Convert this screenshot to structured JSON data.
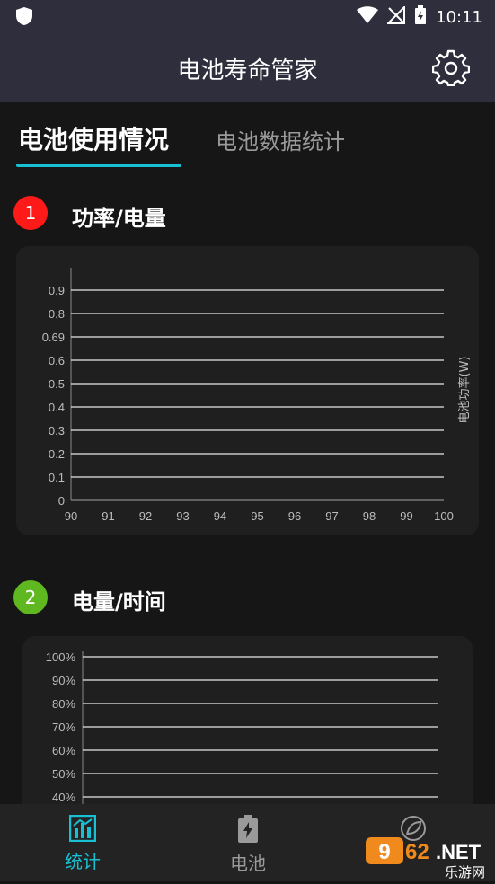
{
  "status_bar": {
    "time": "10:11"
  },
  "app": {
    "title": "电池寿命管家"
  },
  "tabs": [
    {
      "label": "电池使用情况",
      "active": true
    },
    {
      "label": "电池数据统计",
      "active": false
    }
  ],
  "sections": [
    {
      "number": "1",
      "title": "功率/电量",
      "badge_color": "#ff1a1a"
    },
    {
      "number": "2",
      "title": "电量/时间",
      "badge_color": "#5fb820"
    }
  ],
  "chart_data": [
    {
      "type": "line",
      "x": [],
      "series": [],
      "xticks": [
        "90",
        "91",
        "92",
        "93",
        "94",
        "95",
        "96",
        "97",
        "98",
        "99",
        "100"
      ],
      "yticks": [
        "0",
        "0.1",
        "0.2",
        "0.3",
        "0.4",
        "0.5",
        "0.6",
        "0.69",
        "0.8",
        "0.9"
      ],
      "xlabel": "",
      "ylabel": "电池功率(W)",
      "xlim": [
        90,
        100
      ],
      "ylim": [
        0,
        0.9
      ],
      "grid": true
    },
    {
      "type": "line",
      "x": [],
      "series": [],
      "yticks": [
        "40%",
        "50%",
        "60%",
        "70%",
        "80%",
        "90%",
        "100%"
      ],
      "ylim": [
        40,
        100
      ],
      "grid": true
    }
  ],
  "bottom_nav": [
    {
      "label": "统计",
      "icon": "chart-icon",
      "active": true
    },
    {
      "label": "电池",
      "icon": "battery-icon",
      "active": false
    },
    {
      "label": "",
      "icon": "leaf-icon",
      "active": false
    }
  ],
  "watermark": {
    "text": "962.NET",
    "subtext": "乐游网"
  },
  "colors": {
    "accent": "#17c0d3",
    "active_nav": "#17c0d3",
    "inactive_nav": "#9a9a9a"
  }
}
